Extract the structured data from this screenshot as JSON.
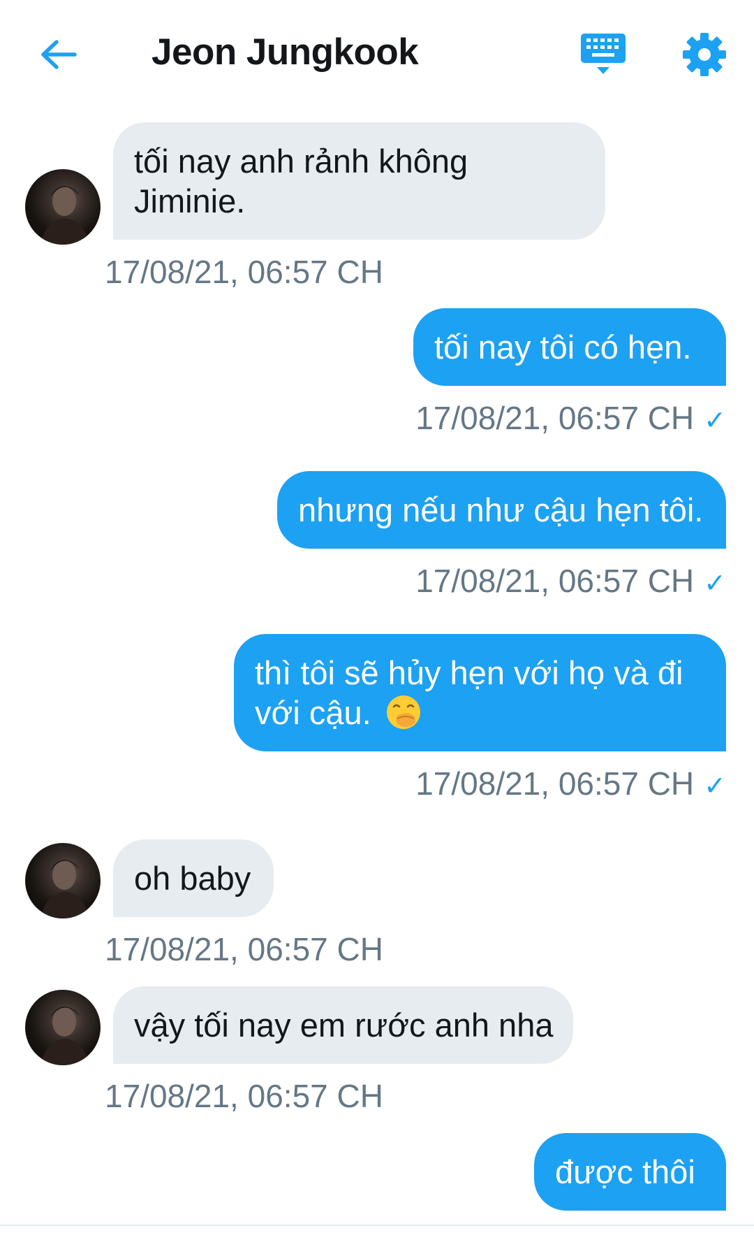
{
  "header": {
    "title": "Jeon Jungkook"
  },
  "colors": {
    "accent": "#1da1f2",
    "incoming_bubble": "#e6ecf0",
    "timestamp": "#657786"
  },
  "icons": {
    "back": "arrow-left-icon",
    "keyboard": "keyboard-icon",
    "settings": "gear-icon"
  },
  "messages": [
    {
      "direction": "in",
      "lines": [
        "tối nay anh rảnh không",
        "Jiminie."
      ],
      "time": "17/08/21, 06:57 CH"
    },
    {
      "direction": "out",
      "lines": [
        "tối nay tôi có hẹn."
      ],
      "time": "17/08/21, 06:57 CH",
      "status": "✓"
    },
    {
      "direction": "out",
      "lines": [
        "nhưng nếu như cậu hẹn tôi."
      ],
      "time": "17/08/21, 06:57 CH",
      "status": "✓"
    },
    {
      "direction": "out",
      "lines": [
        "thì tôi sẽ hủy hẹn với họ và đi",
        "với cậu."
      ],
      "emoji": "face-with-hand-over-mouth-emoji",
      "time": "17/08/21, 06:57 CH",
      "status": "✓"
    },
    {
      "direction": "in",
      "lines": [
        "oh baby"
      ],
      "time": "17/08/21, 06:57 CH"
    },
    {
      "direction": "in",
      "lines": [
        "vậy tối nay em rước anh nha"
      ],
      "time": "17/08/21, 06:57 CH"
    },
    {
      "direction": "out",
      "lines": [
        "được thôi"
      ]
    }
  ]
}
